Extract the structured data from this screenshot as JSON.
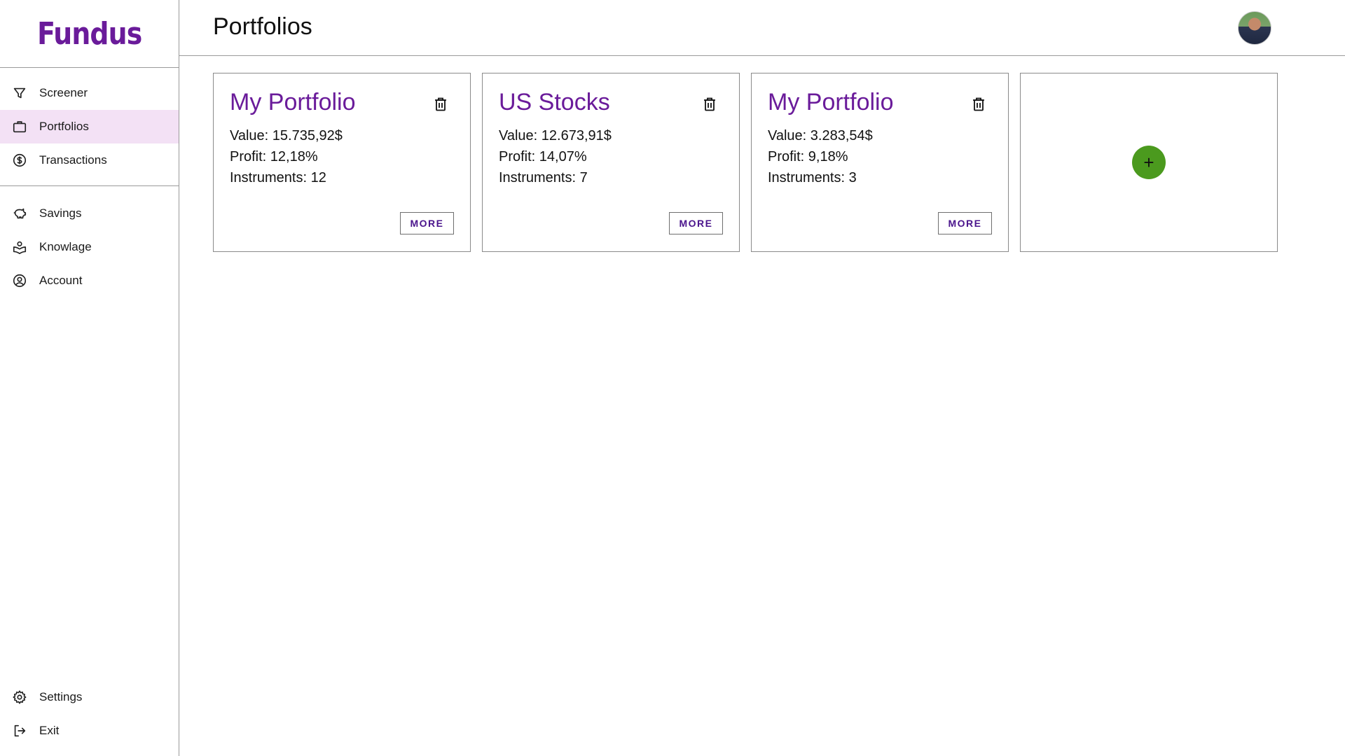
{
  "app": {
    "logo": "Fundus",
    "brand_color": "#6a1b9a",
    "active_bg": "#f3e1f5"
  },
  "sidebar": {
    "primary": [
      {
        "label": "Screener",
        "icon": "filter-icon"
      },
      {
        "label": "Portfolios",
        "icon": "briefcase-icon",
        "active": true
      },
      {
        "label": "Transactions",
        "icon": "dollar-circle-icon"
      }
    ],
    "secondary": [
      {
        "label": "Savings",
        "icon": "piggy-bank-icon"
      },
      {
        "label": "Knowlage",
        "icon": "book-user-icon"
      },
      {
        "label": "Account",
        "icon": "user-circle-icon"
      }
    ],
    "bottom": [
      {
        "label": "Settings",
        "icon": "gear-icon"
      },
      {
        "label": "Exit",
        "icon": "logout-icon"
      }
    ]
  },
  "header": {
    "title": "Portfolios",
    "avatar": "user-avatar"
  },
  "portfolios": [
    {
      "title": "My Portfolio",
      "value": "Value: 15.735,92$",
      "profit": "Profit: 12,18%",
      "instruments": "Instruments: 12",
      "more": "MORE"
    },
    {
      "title": "US Stocks",
      "value": "Value: 12.673,91$",
      "profit": "Profit: 14,07%",
      "instruments": "Instruments: 7",
      "more": "MORE"
    },
    {
      "title": "My Portfolio",
      "value": "Value: 3.283,54$",
      "profit": "Profit: 9,18%",
      "instruments": "Instruments: 3",
      "more": "MORE"
    }
  ],
  "add_card": {
    "icon": "plus-icon",
    "symbol": "+",
    "color": "#4b9a1e"
  }
}
